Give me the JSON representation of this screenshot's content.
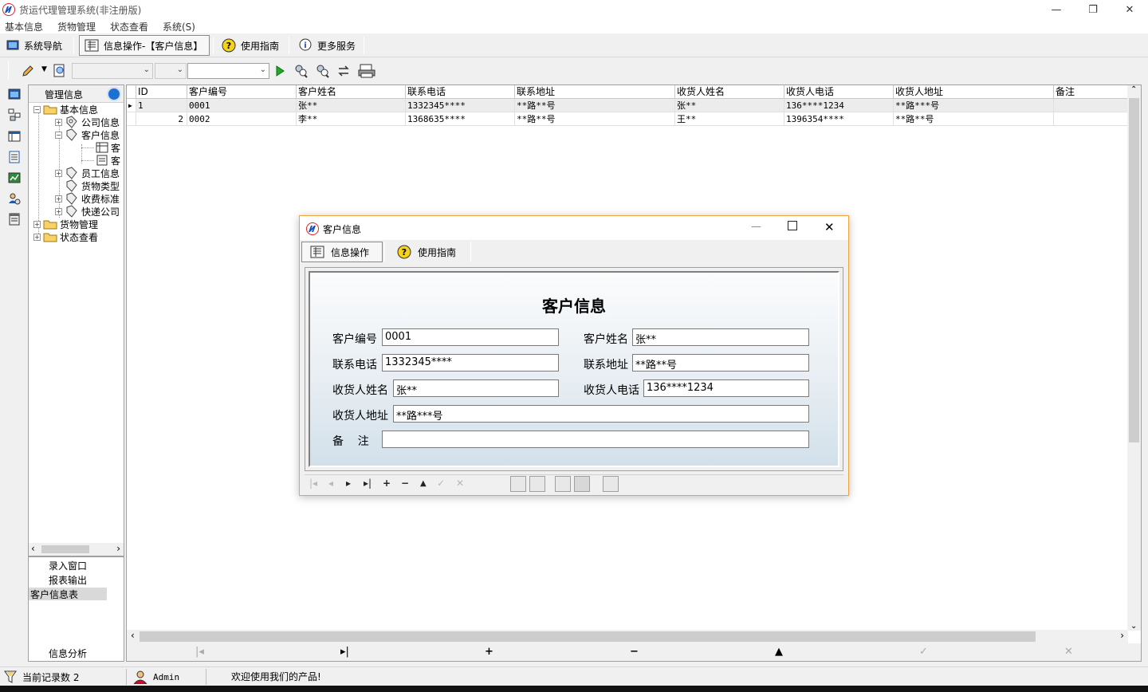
{
  "app": {
    "title": "货运代理管理系统(非注册版)"
  },
  "menu": [
    "基本信息",
    "货物管理",
    "状态查看",
    "系统(S)"
  ],
  "toolbar": {
    "nav_label": "系统导航",
    "info_label": "信息操作-【客户信息】",
    "guide_label": "使用指南",
    "more_label": "更多服务"
  },
  "tree": {
    "header": "管理信息",
    "nodes": [
      "基本信息",
      "公司信息",
      "客户信息",
      "客",
      "客",
      "员工信息",
      "货物类型",
      "收费标准",
      "快递公司",
      "货物管理",
      "状态查看"
    ]
  },
  "left_list": [
    "录入窗口",
    "报表输出",
    "客户信息表",
    "信息分析"
  ],
  "grid": {
    "columns": [
      "ID",
      "客户编号",
      "客户姓名",
      "联系电话",
      "联系地址",
      "收货人姓名",
      "收货人电话",
      "收货人地址",
      "备注"
    ],
    "rows": [
      [
        "1",
        "0001",
        "张**",
        "1332345****",
        "**路**号",
        "张**",
        "136****1234",
        "**路***号",
        ""
      ],
      [
        "2",
        "0002",
        "李**",
        "1368635****",
        "**路**号",
        "王**",
        "1396354****",
        "**路**号",
        ""
      ]
    ]
  },
  "status": {
    "records_label": "当前记录数 2",
    "user": "Admin",
    "welcome": "欢迎使用我们的产品!"
  },
  "dialog": {
    "title": "客户信息",
    "tab_info": "信息操作",
    "tab_guide": "使用指南",
    "form_title": "客户信息",
    "fields": {
      "code_label": "客户编号",
      "code_value": "0001",
      "name_label": "客户姓名",
      "name_value": "张**",
      "phone_label": "联系电话",
      "phone_value": "1332345****",
      "address_label": "联系地址",
      "address_value": "**路**号",
      "recv_name_label": "收货人姓名",
      "recv_name_value": "张**",
      "recv_phone_label": "收货人电话",
      "recv_phone_value": "136****1234",
      "recv_addr_label": "收货人地址",
      "recv_addr_value": "**路***号",
      "note_label": "备    注",
      "note_value": ""
    }
  },
  "colors": {
    "accent": "#1f6fd0",
    "dialog_border": "#f0a33c",
    "selected_row": "#ececec"
  }
}
